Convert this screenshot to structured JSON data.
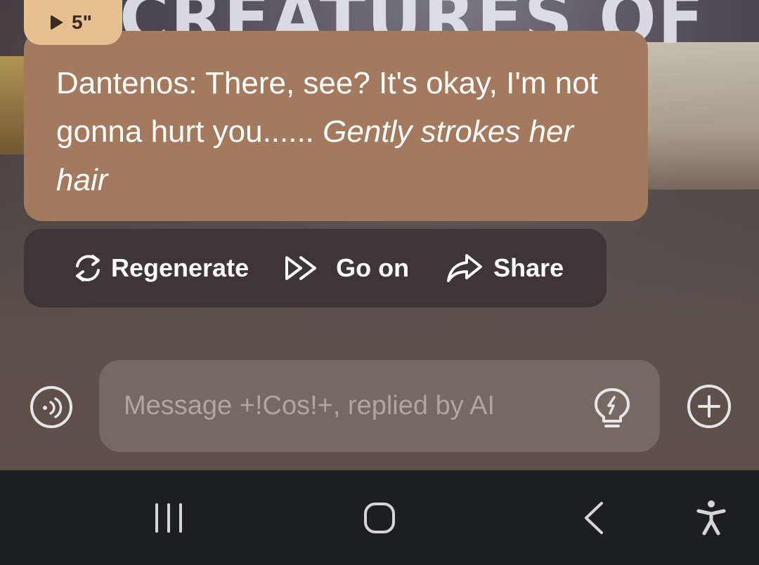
{
  "background": {
    "banner_text": "CREATURES OF"
  },
  "message": {
    "duration": "5\"",
    "speaker_line": "Dantenos: There, see? It's okay, I'm not gonna hurt you......",
    "action_text": "Gently strokes her hair",
    "bubble_color": "#a47a5f",
    "tag_color": "#e6c08f"
  },
  "actions": {
    "regenerate_label": "Regenerate",
    "go_on_label": "Go on",
    "share_label": "Share"
  },
  "composer": {
    "placeholder": "Message +!Cos!+, replied by AI",
    "voice_icon": "voice-mode-icon",
    "hint_icon": "lightbulb-icon",
    "add_icon": "plus-circle-icon"
  },
  "navbar": {
    "recents_icon": "recent-apps-icon",
    "home_icon": "home-icon",
    "back_icon": "back-icon",
    "accessibility_icon": "accessibility-icon"
  }
}
